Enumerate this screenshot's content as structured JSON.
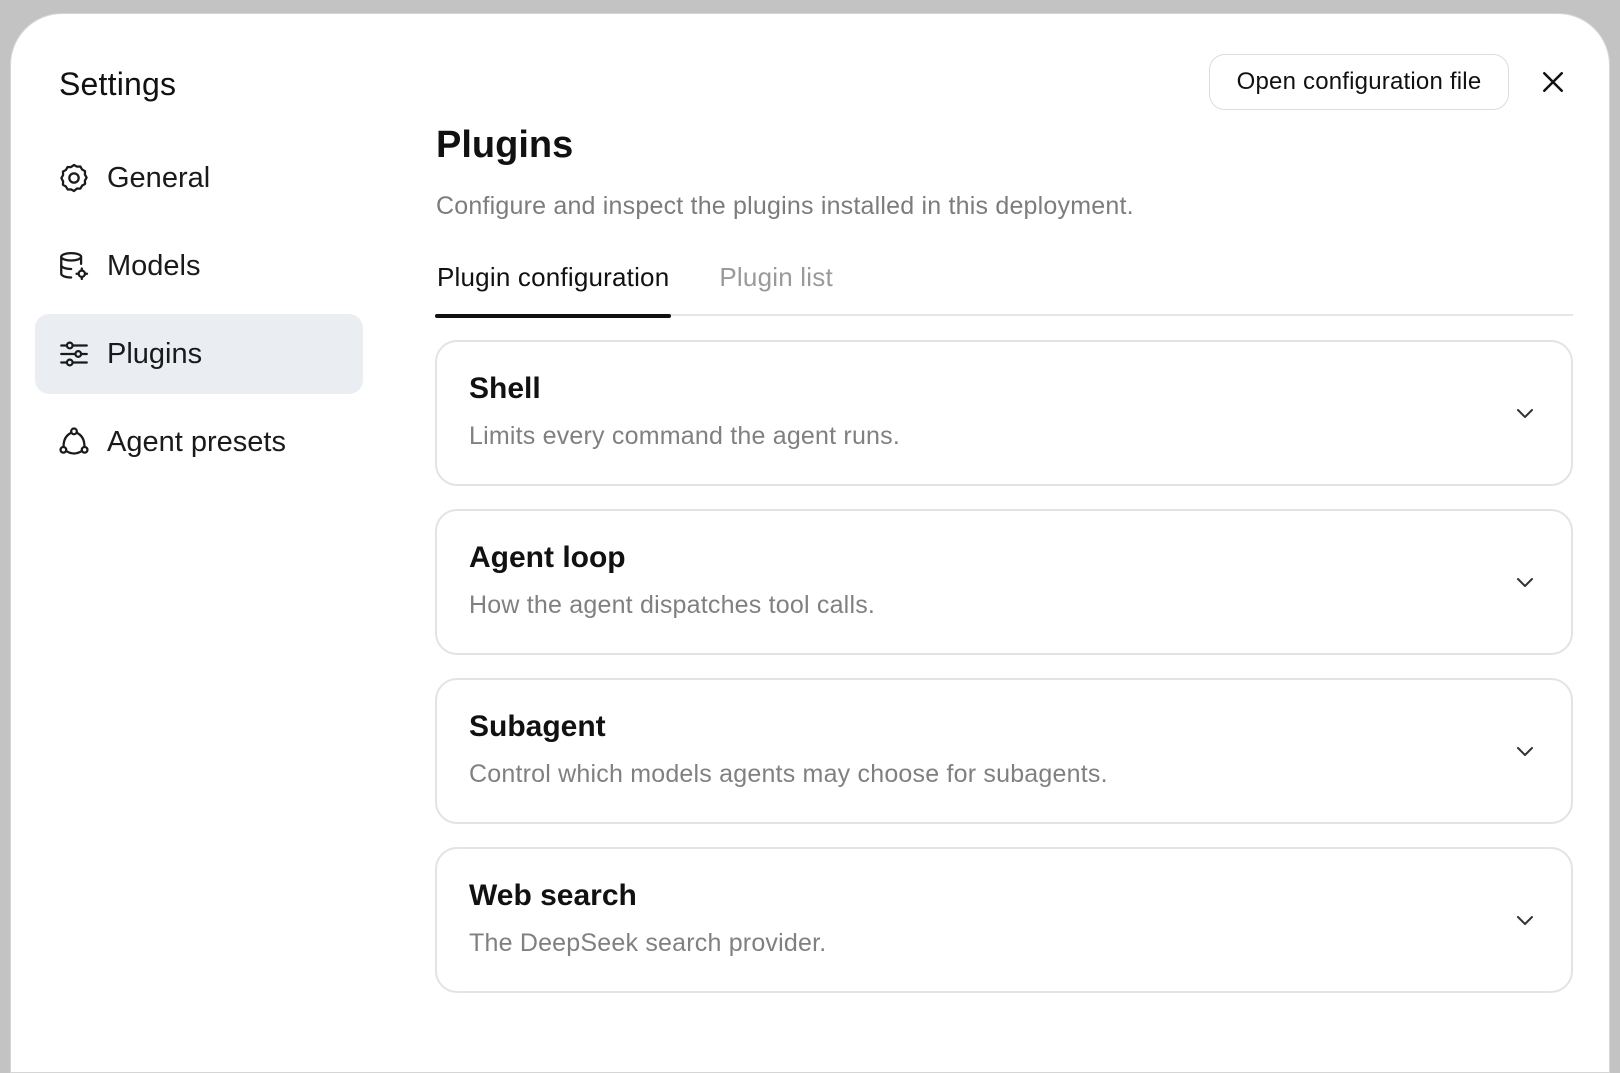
{
  "window": {
    "title": "Settings"
  },
  "sidebar": {
    "items": [
      {
        "label": "General",
        "icon": "gear-icon",
        "active": false
      },
      {
        "label": "Models",
        "icon": "database-gear-icon",
        "active": false
      },
      {
        "label": "Plugins",
        "icon": "sliders-icon",
        "active": true
      },
      {
        "label": "Agent presets",
        "icon": "network-icon",
        "active": false
      }
    ]
  },
  "header": {
    "open_config_label": "Open configuration file",
    "close_icon": "close-icon"
  },
  "main": {
    "title": "Plugins",
    "description": "Configure and inspect the plugins installed in this deployment.",
    "tabs": [
      {
        "label": "Plugin configuration",
        "active": true
      },
      {
        "label": "Plugin list",
        "active": false
      }
    ],
    "plugins": [
      {
        "name": "Shell",
        "description": "Limits every command the agent runs."
      },
      {
        "name": "Agent loop",
        "description": "How the agent dispatches tool calls."
      },
      {
        "name": "Subagent",
        "description": "Control which models agents may choose for subagents."
      },
      {
        "name": "Web search",
        "description": "The DeepSeek search provider."
      }
    ]
  },
  "colors": {
    "active_nav_bg": "#eaeef3",
    "muted_text": "#7c7c7c",
    "border": "#e3e3e3"
  }
}
